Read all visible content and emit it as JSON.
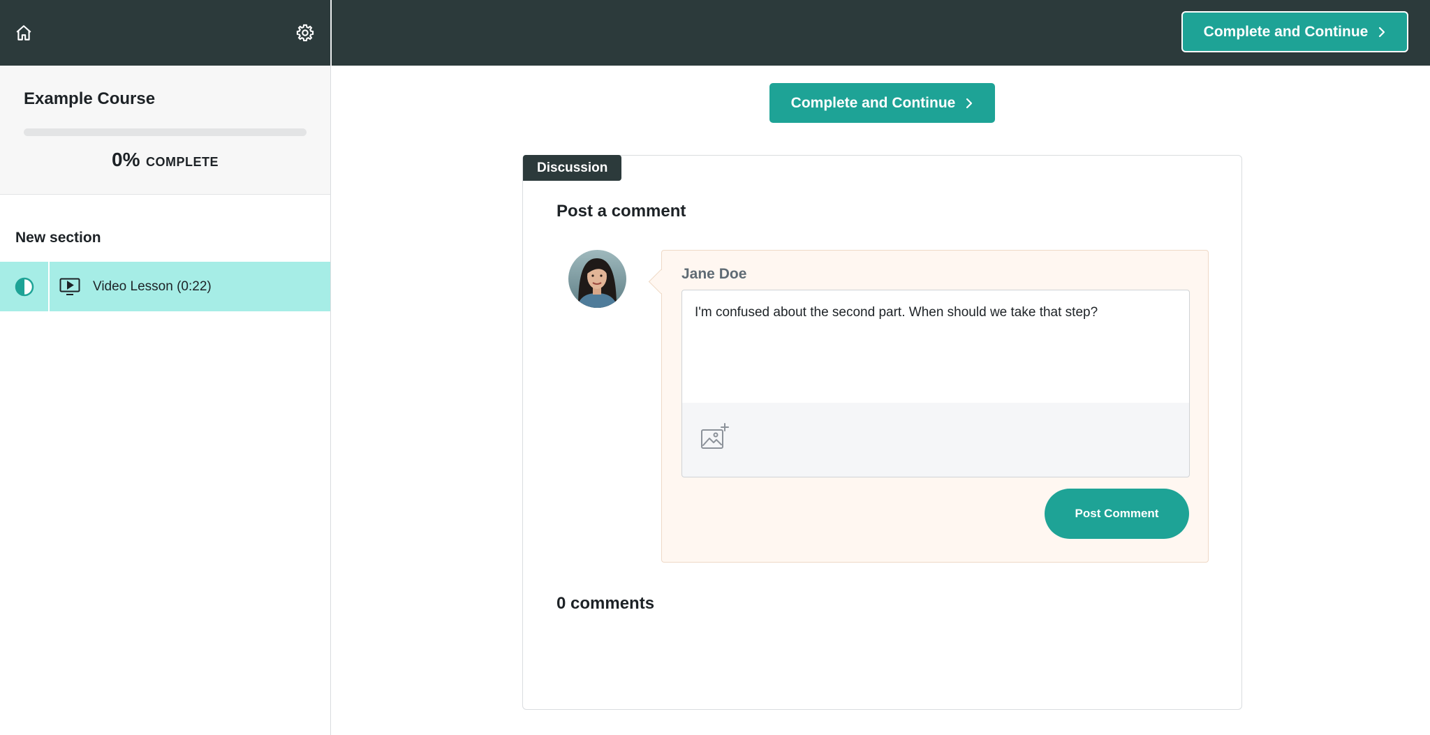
{
  "sidebar": {
    "course_title": "Example Course",
    "progress_percent": "0%",
    "progress_value": 0,
    "progress_label": "COMPLETE",
    "section_title": "New section",
    "lessons": [
      {
        "label": "Video Lesson (0:22)",
        "status": "in-progress",
        "type": "video"
      }
    ]
  },
  "header": {
    "cta_label": "Complete and Continue"
  },
  "main": {
    "cta_label": "Complete and Continue",
    "discussion": {
      "tag": "Discussion",
      "heading": "Post a comment",
      "author": "Jane Doe",
      "comment_text": "I'm confused about the second part. When should we take that step?",
      "post_button": "Post Comment",
      "comments_count": "0 comments"
    }
  },
  "colors": {
    "header_bg": "#2c3a3b",
    "accent": "#1ea396",
    "lesson_active_bg": "#a6ede6",
    "comment_bg": "#fff7f1"
  },
  "icons": {
    "home": "home-icon",
    "settings": "gear-icon",
    "lesson_status": "half-circle-icon",
    "lesson_type": "video-screen-icon",
    "chevron": "chevron-right-icon",
    "attach": "add-image-icon"
  }
}
